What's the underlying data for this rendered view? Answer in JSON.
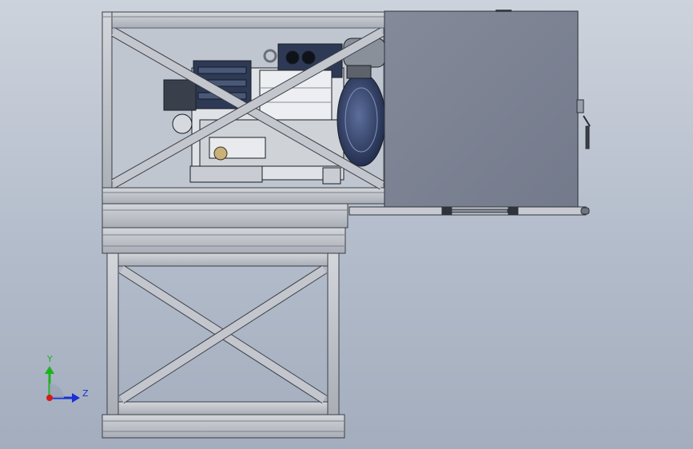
{
  "triad": {
    "y_label": "Y",
    "z_label": "Z",
    "y_color": "#1db31d",
    "z_color": "#1a2fd6",
    "x_color": "#d41b1b"
  },
  "colors": {
    "background_top": "#cdd3dc",
    "background_bottom": "#a3adbd",
    "frame_steel": "#b9bdc4",
    "frame_edge": "#3b3f46",
    "door_panel": "#7d8393",
    "compressor_dark": "#2e3a55",
    "compressor_light": "#dfe2e6"
  }
}
